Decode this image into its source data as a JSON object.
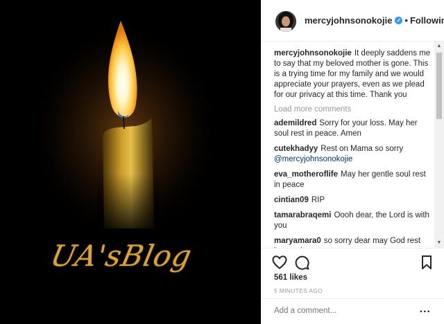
{
  "image": {
    "watermark": "UA'sBlog",
    "accent_color": "#d9a43c"
  },
  "header": {
    "username": "mercyjohnsonokojie",
    "verified_icon": "verified-badge-icon",
    "separator": "•",
    "follow_status": "Following"
  },
  "caption": {
    "user": "mercyjohnsonokojie",
    "text": "It deeply saddens me to say that my beloved mother is gone. This is a trying time for my family and we would appreciate your prayers, even as we plead for our privacy at this time. Thank you"
  },
  "load_more": "Load more comments",
  "comments": [
    {
      "user": "ademildred",
      "text": "Sorry for your loss. May her soul rest in peace. Amen",
      "mention": ""
    },
    {
      "user": "cutekhadyy",
      "text": "Rest on Mama so sorry",
      "mention": "@mercyjohnsonokojie"
    },
    {
      "user": "eva_motheroflife",
      "text": "May her gentle soul rest in peace",
      "mention": ""
    },
    {
      "user": "cintian09",
      "text": "RIP",
      "mention": ""
    },
    {
      "user": "tamarabraqemi",
      "text": "Oooh dear, the Lord is with you",
      "mention": ""
    },
    {
      "user": "maryamara0",
      "text": "so sorry dear may God rest her soul",
      "mention": ""
    }
  ],
  "actions": {
    "like_icon": "heart-icon",
    "comment_icon": "comment-bubble-icon",
    "save_icon": "bookmark-icon",
    "likes": "561 likes",
    "time": "5 MINUTES AGO"
  },
  "add_comment": {
    "placeholder": "Add a comment...",
    "more": "..."
  },
  "scrollbar": {
    "up": "▲",
    "down": "▼"
  }
}
